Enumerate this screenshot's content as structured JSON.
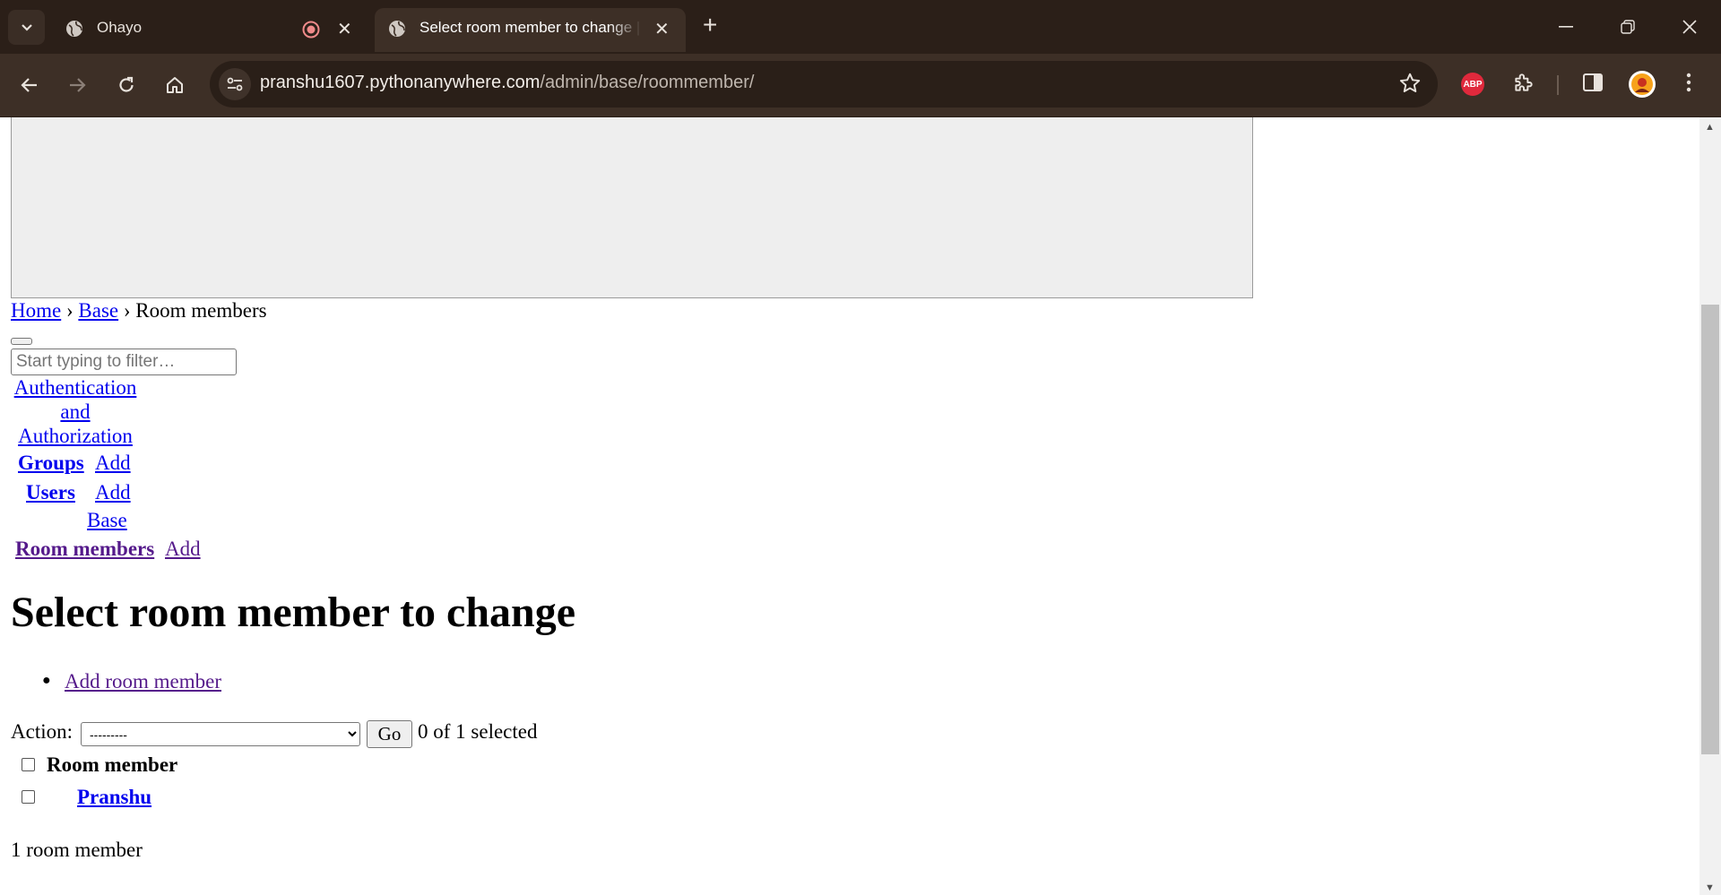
{
  "browser": {
    "tabs": [
      {
        "title": "Ohayo",
        "active": false
      },
      {
        "title": "Select room member to change | Django site admin",
        "active": true
      }
    ],
    "url_host": "pranshu1607.pythonanywhere.com",
    "url_path": "/admin/base/roommember/",
    "extension_abp_label": "ABP",
    "icons": {
      "tab_search": "chevron-down-icon",
      "favicon": "globe-icon",
      "recording": "record-icon",
      "close": "close-icon",
      "new_tab": "plus-icon",
      "minimize": "minimize-icon",
      "restore": "restore-icon",
      "window_close": "close-icon",
      "back": "arrow-left-icon",
      "forward": "arrow-right-icon",
      "reload": "reload-icon",
      "home": "home-icon",
      "site_info": "tune-icon",
      "bookmark": "star-icon",
      "extensions": "puzzle-icon",
      "side_panel": "side-panel-icon",
      "menu": "kebab-menu-icon"
    },
    "colors": {
      "frame": "#2b1f18",
      "toolbar": "#3d2f26",
      "abp": "#e0293c"
    }
  },
  "breadcrumbs": {
    "home": "Home",
    "sep1": "›",
    "base": "Base",
    "sep2": "›",
    "current": "Room members"
  },
  "nav": {
    "filter_placeholder": "Start typing to filter…",
    "auth_caption_lines": [
      "Authentication",
      "and",
      "Authorization"
    ],
    "groups_label": "Groups",
    "groups_add": "Add",
    "users_label": "Users",
    "users_add": "Add",
    "base_caption": "Base",
    "roommembers_label": "Room members",
    "roommembers_add": "Add"
  },
  "content": {
    "title": "Select room member to change",
    "add_link": "Add room member",
    "action_label": "Action:",
    "action_selected": "---------",
    "go_label": "Go",
    "selected_count": "0 of 1 selected",
    "column_header": "Room member",
    "rows": [
      "Pranshu"
    ],
    "paginator": "1 room member"
  }
}
